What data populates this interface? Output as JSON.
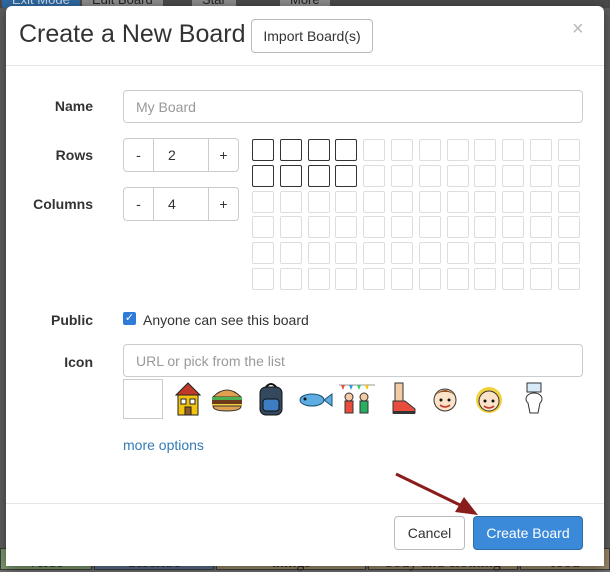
{
  "background": {
    "tabs": [
      "Exit Mode",
      "Edit Board",
      "Star",
      "More"
    ],
    "bottom_words": [
      "verbs",
      "describe",
      "things",
      "body and clothing",
      "food"
    ]
  },
  "modal": {
    "title": "Create a New Board",
    "import_label": "Import Board(s)",
    "close_symbol": "×",
    "name": {
      "label": "Name",
      "placeholder": "My Board",
      "value": ""
    },
    "rows": {
      "label": "Rows",
      "value": "2",
      "minus": "-",
      "plus": "+"
    },
    "columns": {
      "label": "Columns",
      "value": "4",
      "minus": "-",
      "plus": "+"
    },
    "grid": {
      "total_rows": 6,
      "total_cols": 12,
      "selected_rows": 2,
      "selected_cols": 4
    },
    "public": {
      "label": "Public",
      "checked": true,
      "checkbox_label": "Anyone can see this board"
    },
    "icon": {
      "label": "Icon",
      "placeholder": "URL or pick from the list",
      "options": [
        "blank",
        "house-icon",
        "hamburger-icon",
        "backpack-icon",
        "fish-icon",
        "party-people-icon",
        "sneaker-icon",
        "boy-face-icon",
        "girl-face-icon",
        "toilet-icon"
      ]
    },
    "more_options": "more options",
    "cancel_label": "Cancel",
    "create_label": "Create Board"
  },
  "colors": {
    "primary": "#3b8ad9",
    "link": "#337ab7",
    "arrow": "#8b1c1c"
  }
}
